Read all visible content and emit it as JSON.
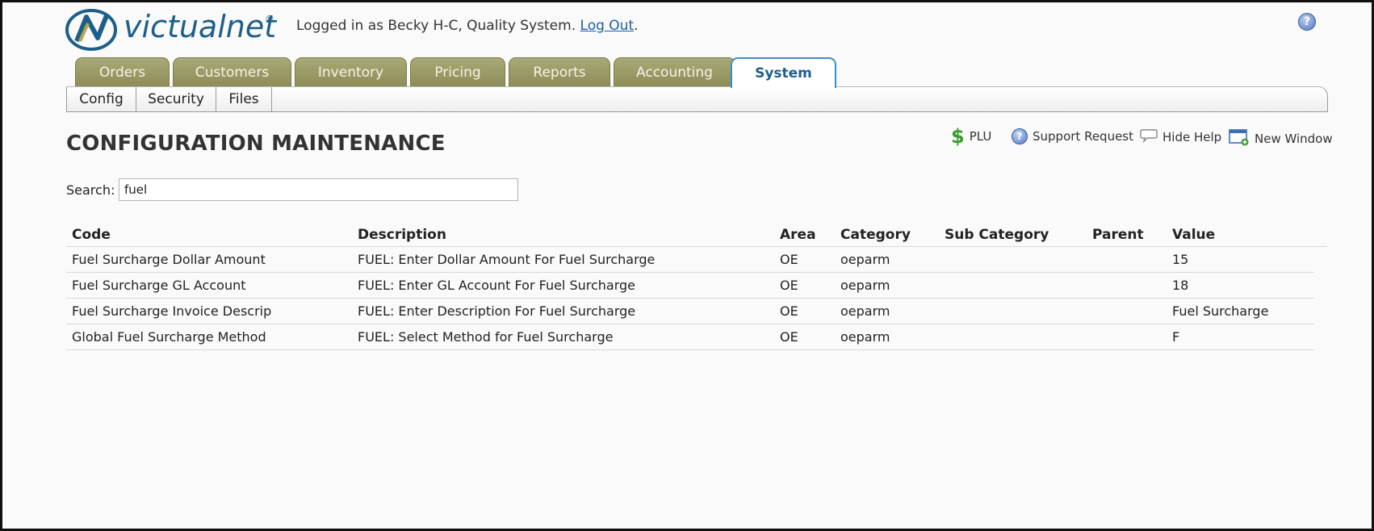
{
  "header": {
    "logo_text": "victualnet",
    "logo_reg": "®",
    "login_prefix": "Logged in as Becky H-C, Quality System.",
    "logout_label": "Log Out",
    "logout_suffix": ".",
    "help_icon": "help-icon"
  },
  "tabs": [
    {
      "label": "Orders",
      "active": false
    },
    {
      "label": "Customers",
      "active": false
    },
    {
      "label": "Inventory",
      "active": false
    },
    {
      "label": "Pricing",
      "active": false
    },
    {
      "label": "Reports",
      "active": false
    },
    {
      "label": "Accounting",
      "active": false
    },
    {
      "label": "System",
      "active": true
    }
  ],
  "subnav": [
    {
      "label": "Config"
    },
    {
      "label": "Security"
    },
    {
      "label": "Files"
    }
  ],
  "page": {
    "title": "CONFIGURATION MAINTENANCE"
  },
  "actions": {
    "plu": {
      "label": "PLU",
      "icon": "dollar-icon"
    },
    "support": {
      "label": "Support Request",
      "icon": "support-icon"
    },
    "hide_help": {
      "label": "Hide Help",
      "icon": "speech-bubble-icon"
    },
    "new_window": {
      "label": "New Window",
      "icon": "new-window-icon"
    }
  },
  "search": {
    "label": "Search:",
    "value": "fuel"
  },
  "table": {
    "headers": {
      "code": "Code",
      "description": "Description",
      "area": "Area",
      "category": "Category",
      "sub_category": "Sub Category",
      "parent": "Parent",
      "value": "Value"
    },
    "rows": [
      {
        "code": "Fuel Surcharge Dollar Amount",
        "description": "FUEL: Enter Dollar Amount For Fuel Surcharge",
        "area": "OE",
        "category": "oeparm",
        "sub_category": "",
        "parent": "",
        "value": "15"
      },
      {
        "code": "Fuel Surcharge GL Account",
        "description": "FUEL: Enter GL Account For Fuel Surcharge",
        "area": "OE",
        "category": "oeparm",
        "sub_category": "",
        "parent": "",
        "value": "18"
      },
      {
        "code": "Fuel Surcharge Invoice Descrip",
        "description": "FUEL: Enter Description For Fuel Surcharge",
        "area": "OE",
        "category": "oeparm",
        "sub_category": "",
        "parent": "",
        "value": "Fuel Surcharge"
      },
      {
        "code": "Global Fuel Surcharge Method",
        "description": "FUEL: Select Method for Fuel Surcharge",
        "area": "OE",
        "category": "oeparm",
        "sub_category": "",
        "parent": "",
        "value": "F"
      }
    ]
  },
  "colors": {
    "tab_inactive": "#9a9a66",
    "tab_active_border": "#3b8ec4",
    "brand_blue": "#1d5f8a",
    "plu_green": "#3a9b2e"
  }
}
